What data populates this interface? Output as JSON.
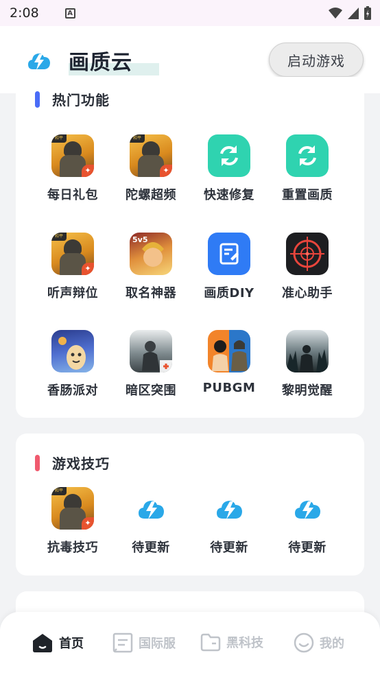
{
  "status_bar": {
    "time": "2:08",
    "notification_icon": "A"
  },
  "header": {
    "title": "画质云",
    "launch_button": "启动游戏"
  },
  "sections": [
    {
      "title": "热门功能",
      "accent": "#4a6cf7",
      "items": [
        {
          "label": "每日礼包",
          "icon": "pubg-icon"
        },
        {
          "label": "陀螺超频",
          "icon": "pubg-icon"
        },
        {
          "label": "快速修复",
          "icon": "refresh-icon"
        },
        {
          "label": "重置画质",
          "icon": "refresh-icon"
        },
        {
          "label": "听声辩位",
          "icon": "pubg-icon"
        },
        {
          "label": "取名神器",
          "icon": "king-glory-icon"
        },
        {
          "label": "画质DIY",
          "icon": "edit-doc-icon"
        },
        {
          "label": "准心助手",
          "icon": "crosshair-icon"
        },
        {
          "label": "香肠派对",
          "icon": "sausage-party-icon"
        },
        {
          "label": "暗区突围",
          "icon": "arena-breakout-icon"
        },
        {
          "label": "PUBGM",
          "icon": "pubgm-icon"
        },
        {
          "label": "黎明觉醒",
          "icon": "dawn-awakening-icon"
        }
      ]
    },
    {
      "title": "游戏技巧",
      "accent": "#f05a6e",
      "items": [
        {
          "label": "抗毒技巧",
          "icon": "pubg-icon"
        },
        {
          "label": "待更新",
          "icon": "lightning-cloud-icon"
        },
        {
          "label": "待更新",
          "icon": "lightning-cloud-icon"
        },
        {
          "label": "待更新",
          "icon": "lightning-cloud-icon"
        }
      ]
    }
  ],
  "nav": [
    {
      "label": "首页",
      "icon": "home-icon",
      "active": true
    },
    {
      "label": "国际服",
      "icon": "list-icon",
      "active": false
    },
    {
      "label": "黑科技",
      "icon": "folder-icon",
      "active": false
    },
    {
      "label": "我的",
      "icon": "smile-icon",
      "active": false
    }
  ],
  "colors": {
    "brand": "#2aa8e8",
    "nav_inactive": "#bfc3c9"
  }
}
